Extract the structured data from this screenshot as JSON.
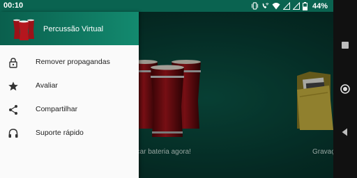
{
  "status_bar": {
    "time": "00:10",
    "battery": "44%",
    "icons": [
      "vibrate-icon",
      "wifi-call-icon",
      "wifi-icon",
      "signal-icon",
      "signal-icon",
      "battery-icon"
    ]
  },
  "drawer": {
    "app_title": "Percussão Virtual",
    "items": [
      {
        "label": "Remover propagandas",
        "icon": "lock-icon"
      },
      {
        "label": "Avaliar",
        "icon": "star-icon"
      },
      {
        "label": "Compartilhar",
        "icon": "share-icon"
      },
      {
        "label": "Suporte rápido",
        "icon": "headset-icon"
      }
    ]
  },
  "background": {
    "caption_left": "ocar bateria agora!",
    "caption_right": "Gravaç"
  },
  "nav_bar": {
    "buttons": [
      "recents-button",
      "home-button",
      "back-button"
    ]
  },
  "colors": {
    "header_green": "#0a6350",
    "drawer_bg": "#fafafa",
    "background_green": "#073a31",
    "drum_red": "#8b0f14"
  }
}
